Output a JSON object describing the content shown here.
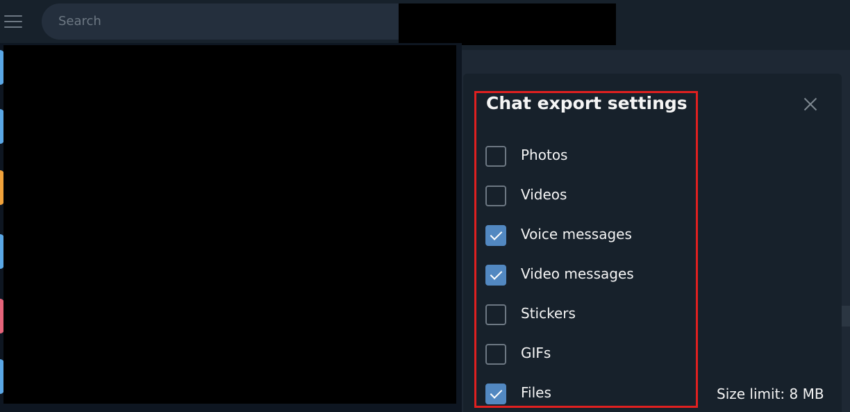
{
  "search": {
    "placeholder": "Search"
  },
  "dialog": {
    "title": "Chat export settings",
    "options": [
      {
        "label": "Photos",
        "checked": false
      },
      {
        "label": "Videos",
        "checked": false
      },
      {
        "label": "Voice messages",
        "checked": true
      },
      {
        "label": "Video messages",
        "checked": true
      },
      {
        "label": "Stickers",
        "checked": false
      },
      {
        "label": "GIFs",
        "checked": false
      },
      {
        "label": "Files",
        "checked": true
      }
    ],
    "size_limit": "Size limit: 8 MB"
  },
  "colors": {
    "accent": "#5288c1",
    "highlight": "#e02020",
    "dialog_bg": "#17212b"
  }
}
